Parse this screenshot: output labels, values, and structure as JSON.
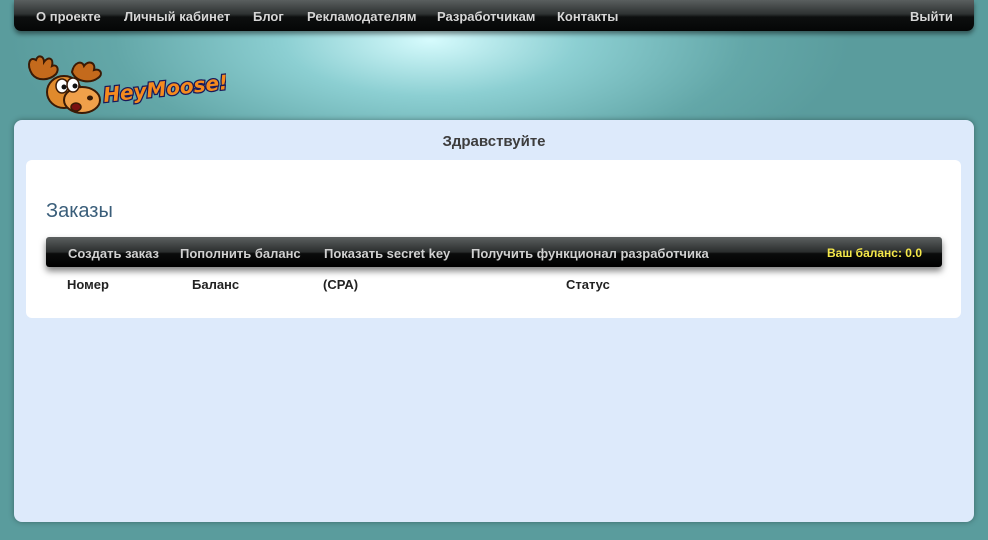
{
  "topnav": {
    "items": [
      "О проекте",
      "Личный кабинет",
      "Блог",
      "Рекламодателям",
      "Разработчикам",
      "Контакты"
    ],
    "logout": "Выйти"
  },
  "logo": {
    "text": "HeyMoose!"
  },
  "greeting": "Здравствуйте",
  "orders": {
    "title": "Заказы",
    "toolbar": [
      "Создать заказ",
      "Пополнить баланс",
      "Показать secret key",
      "Получить функционал разработчика"
    ],
    "balance": "Ваш баланс: 0.0",
    "columns": [
      "Номер",
      "Баланс",
      "(CPA)",
      "Статус"
    ]
  },
  "colors": {
    "accent": "#f5e84a",
    "title": "#3a5e7a",
    "panel_bg": "#ddeafb"
  }
}
